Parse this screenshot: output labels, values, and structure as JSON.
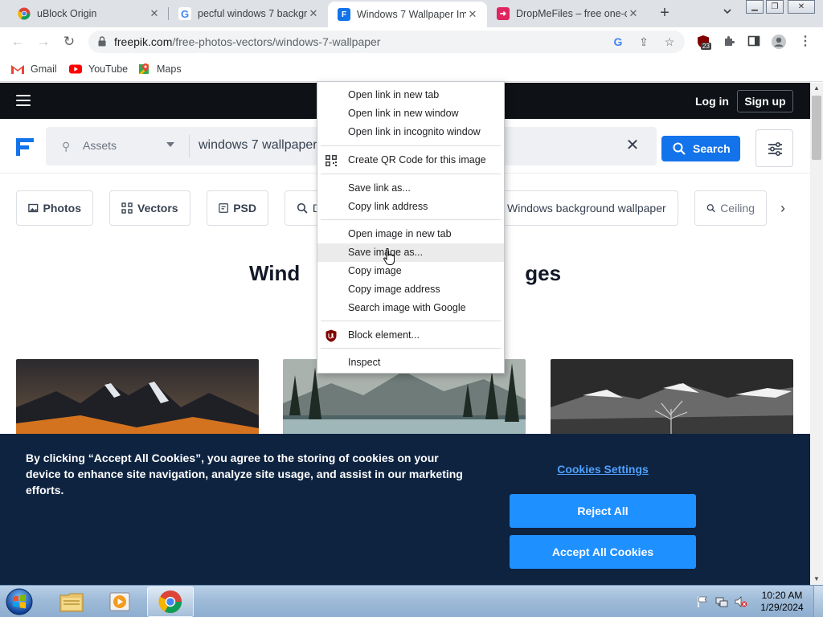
{
  "tabs": [
    {
      "title": "uBlock Origin",
      "favicon": "chrome-icon"
    },
    {
      "title": "pecful windows 7 backgr",
      "favicon": "google-icon"
    },
    {
      "title": "Windows 7 Wallpaper Im",
      "favicon": "freepik-icon"
    },
    {
      "title": "DropMeFiles – free one-c",
      "favicon": "dropmefiles-icon"
    }
  ],
  "toolbar": {
    "url_host": "freepik.com",
    "url_path": "/free-photos-vectors/windows-7-wallpaper",
    "extension_badge": "23"
  },
  "bookmarks": [
    {
      "label": "Gmail",
      "icon": "gmail-icon"
    },
    {
      "label": "YouTube",
      "icon": "youtube-icon"
    },
    {
      "label": "Maps",
      "icon": "maps-icon"
    }
  ],
  "site": {
    "login": "Log in",
    "signup": "Sign up",
    "assets_label": "Assets",
    "search_value": "windows 7 wallpaper",
    "search_button": "Search",
    "chips": [
      {
        "label": "Photos",
        "icon": "image-icon"
      },
      {
        "label": "Vectors",
        "icon": "vector-icon"
      },
      {
        "label": "PSD",
        "icon": "psd-icon"
      },
      {
        "label": "D",
        "icon": "search-icon"
      },
      {
        "label": "Windows background wallpaper",
        "icon": ""
      },
      {
        "label": "Ceiling",
        "icon": "search-icon"
      }
    ],
    "title_left": "Wind",
    "title_right": "ges"
  },
  "context_menu": [
    "Open link in new tab",
    "Open link in new window",
    "Open link in incognito window",
    "Create QR Code for this image",
    "Save link as...",
    "Copy link address",
    "Open image in new tab",
    "Save image as...",
    "Copy image",
    "Copy image address",
    "Search image with Google",
    "Block element...",
    "Inspect"
  ],
  "cookies": {
    "text": "By clicking “Accept All Cookies”, you agree to the storing of cookies on your device to enhance site navigation, analyze site usage, and assist in our marketing efforts.",
    "settings": "Cookies Settings",
    "reject": "Reject All",
    "accept": "Accept All Cookies"
  },
  "taskbar": {
    "time": "10:20 AM",
    "date": "1/29/2024",
    "apps": [
      "explorer-icon",
      "media-player-icon",
      "chrome-icon"
    ]
  },
  "colors": {
    "accent": "#1273eb",
    "cookie_bg": "#0e2340",
    "cookie_button": "#1e90ff",
    "header_bg": "#0e1115"
  }
}
